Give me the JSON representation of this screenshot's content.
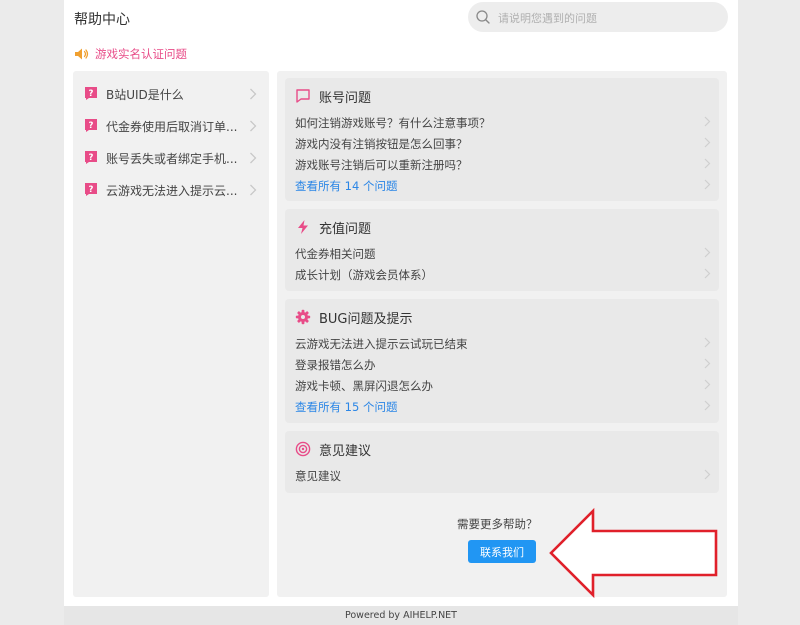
{
  "header": {
    "title": "帮助中心",
    "search_placeholder": "请说明您遇到的问题"
  },
  "notice": {
    "text": "游戏实名认证问题"
  },
  "sidebar": {
    "items": [
      {
        "label": "B站UID是什么"
      },
      {
        "label": "代金券使用后取消订单..."
      },
      {
        "label": "账号丢失或者绑定手机..."
      },
      {
        "label": "云游戏无法进入提示云..."
      }
    ]
  },
  "categories": [
    {
      "title": "账号问题",
      "icon": "flag-icon",
      "questions": [
        "如何注销游戏账号？有什么注意事项？",
        "游戏内没有注销按钮是怎么回事？",
        "游戏账号注销后可以重新注册吗？"
      ],
      "view_all": "查看所有 14 个问题"
    },
    {
      "title": "充值问题",
      "icon": "lightning-icon",
      "questions": [
        "代金券相关问题",
        "成长计划（游戏会员体系）"
      ]
    },
    {
      "title": "BUG问题及提示",
      "icon": "gear-icon",
      "questions": [
        "云游戏无法进入提示云试玩已结束",
        "登录报错怎么办",
        "游戏卡顿、黑屏闪退怎么办"
      ],
      "view_all": "查看所有 15 个问题"
    },
    {
      "title": "意见建议",
      "icon": "target-icon",
      "questions": [
        "意见建议"
      ]
    }
  ],
  "help": {
    "text": "需要更多帮助？",
    "button": "联系我们"
  },
  "footer": {
    "text": "Powered by AIHELP.NET"
  },
  "colors": {
    "accent_pink": "#e84c88",
    "link_blue": "#2b86e6",
    "button_blue": "#2196f3",
    "arrow_red": "#e0202a"
  }
}
